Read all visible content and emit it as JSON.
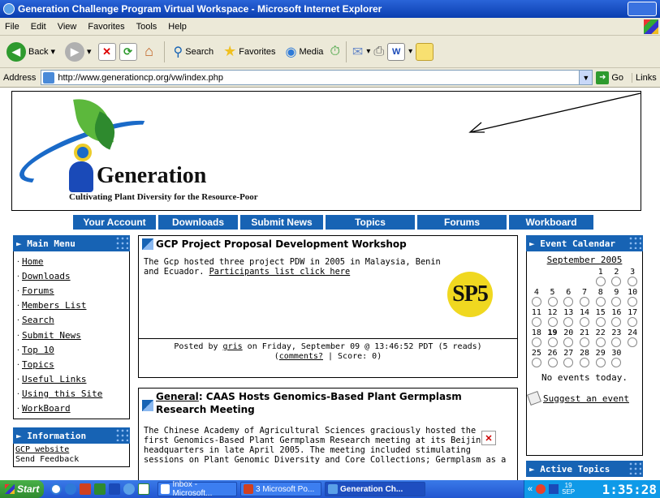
{
  "window": {
    "title": "Generation Challenge Program Virtual Workspace - Microsoft Internet Explorer"
  },
  "menu": [
    "File",
    "Edit",
    "View",
    "Favorites",
    "Tools",
    "Help"
  ],
  "toolbar": {
    "back": "Back",
    "search": "Search",
    "favorites": "Favorites",
    "media": "Media"
  },
  "address": {
    "label": "Address",
    "url": "http://www.generationcp.org/vw/index.php",
    "go": "Go",
    "links": "Links"
  },
  "header": {
    "title": "Generation",
    "subtitle": "Cultivating Plant Diversity for the Resource-Poor"
  },
  "nav": [
    "Your Account",
    "Downloads",
    "Submit News",
    "Topics",
    "Forums",
    "Workboard"
  ],
  "main_menu": {
    "title": "Main Menu",
    "items": [
      "Home",
      "Downloads",
      "Forums",
      "Members List",
      "Search",
      "Submit News",
      "Top 10",
      "Topics",
      "Useful Links",
      "Using this Site",
      "WorkBoard"
    ]
  },
  "information": {
    "title": "Information",
    "items": [
      "GCP website",
      "Send Feedback"
    ]
  },
  "story1": {
    "title": "GCP Project Proposal Development Workshop",
    "body1": "The Gcp hosted three project PDW in 2005 in Malaysia, Benin",
    "body2": "and Ecuador.",
    "link": "Participants list click here",
    "image_text": "SP5",
    "posted_pre": "Posted by",
    "author": "gris",
    "posted_post": "on Friday, September 09 @ 13:46:52 PDT (5 reads)",
    "comments": "comments?",
    "score": "| Score: 0)"
  },
  "story2": {
    "topic": "General",
    "title": ": CAAS Hosts Genomics-Based Plant Germplasm Research Meeting",
    "lines": [
      "The Chinese Academy of Agricultural Sciences graciously hosted the",
      "first Genomics-Based Plant Germplasm Research meeting at its Beijing",
      "headquarters in late April 2005. The meeting included stimulating",
      "sessions on Plant Genomic Diversity and Core Collections; Germplasm as a"
    ]
  },
  "calendar": {
    "title": "Event Calendar",
    "month": "September 2005",
    "weeks": [
      [
        "",
        "",
        "",
        "",
        "1",
        "2",
        "3"
      ],
      [
        "4",
        "5",
        "6",
        "7",
        "8",
        "9",
        "10"
      ],
      [
        "11",
        "12",
        "13",
        "14",
        "15",
        "16",
        "17"
      ],
      [
        "18",
        "19",
        "20",
        "21",
        "22",
        "23",
        "24"
      ],
      [
        "25",
        "26",
        "27",
        "28",
        "29",
        "30",
        ""
      ]
    ],
    "today": "19",
    "no_events": "No events today.",
    "suggest": "Suggest an event"
  },
  "active_topics": {
    "title": "Active Topics"
  },
  "taskbar": {
    "start": "Start",
    "tasks": [
      "Inbox - Microsoft...",
      "3 Microsoft Po...",
      "Generation Ch..."
    ],
    "date_day": "19",
    "date_month": "SEP",
    "clock": "1:35:28"
  }
}
